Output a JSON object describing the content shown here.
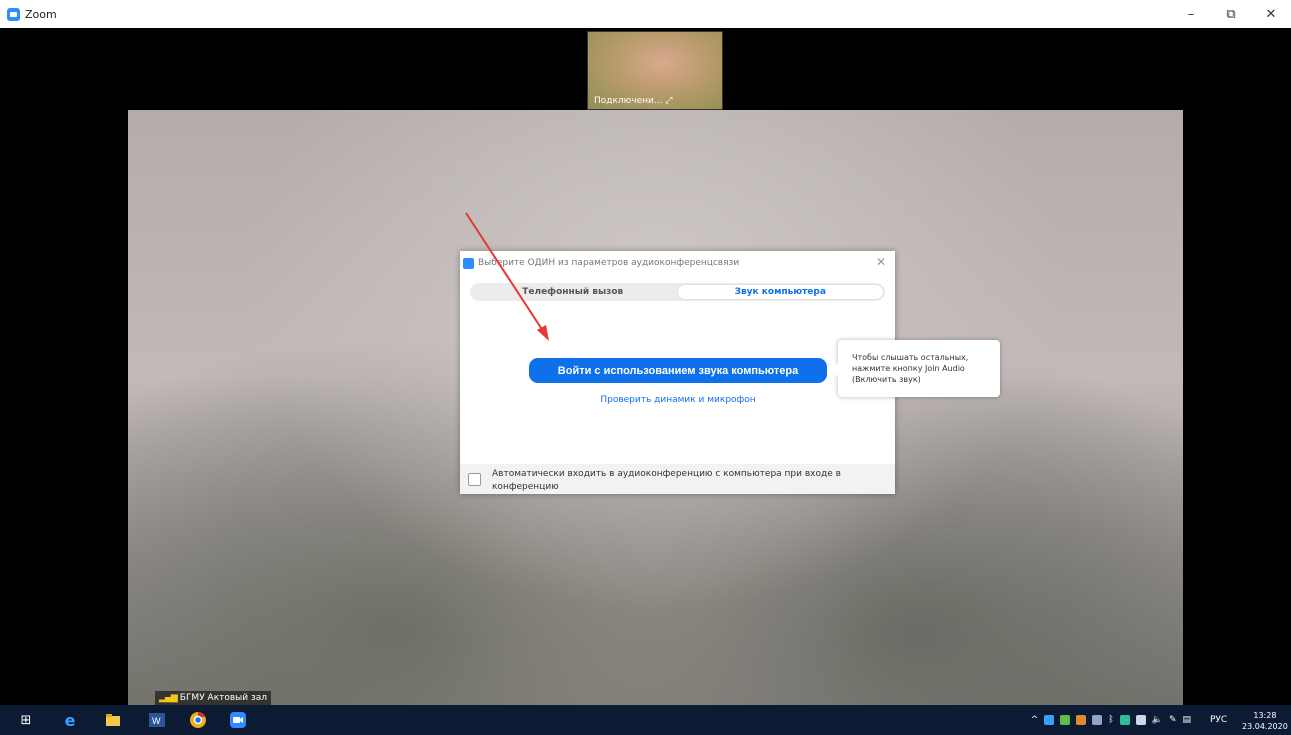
{
  "window": {
    "title": "Zoom",
    "minimize": "–",
    "restore": "⧉",
    "close": "✕"
  },
  "thumbnail": {
    "label": "Подключени... ⤢"
  },
  "room": {
    "label": "БГМУ Актовый зал"
  },
  "dialog": {
    "title": "Выберите ОДИН из параметров аудиоконференцсвязи",
    "close": "✕",
    "tabs": [
      {
        "label": "Телефонный вызов",
        "active": false
      },
      {
        "label": "Звук компьютера",
        "active": true
      }
    ],
    "join_button": "Войти с использованием звука компьютера",
    "test_link": "Проверить динамик и микрофон",
    "auto_join_text": "Автоматически входить в аудиоконференцию с компьютера при входе в конференцию",
    "auto_join_checked": false
  },
  "tooltip": {
    "text": "Чтобы слышать остальных, нажмите кнопку Join Audio (Включить звук)"
  },
  "taskbar": {
    "start": "⊞",
    "lang": "РУС",
    "time": "13:28",
    "date": "23.04.2020"
  },
  "colors": {
    "accent": "#0e71eb",
    "taskbar": "#0d1a33",
    "annotation_arrow": "#e53935"
  }
}
